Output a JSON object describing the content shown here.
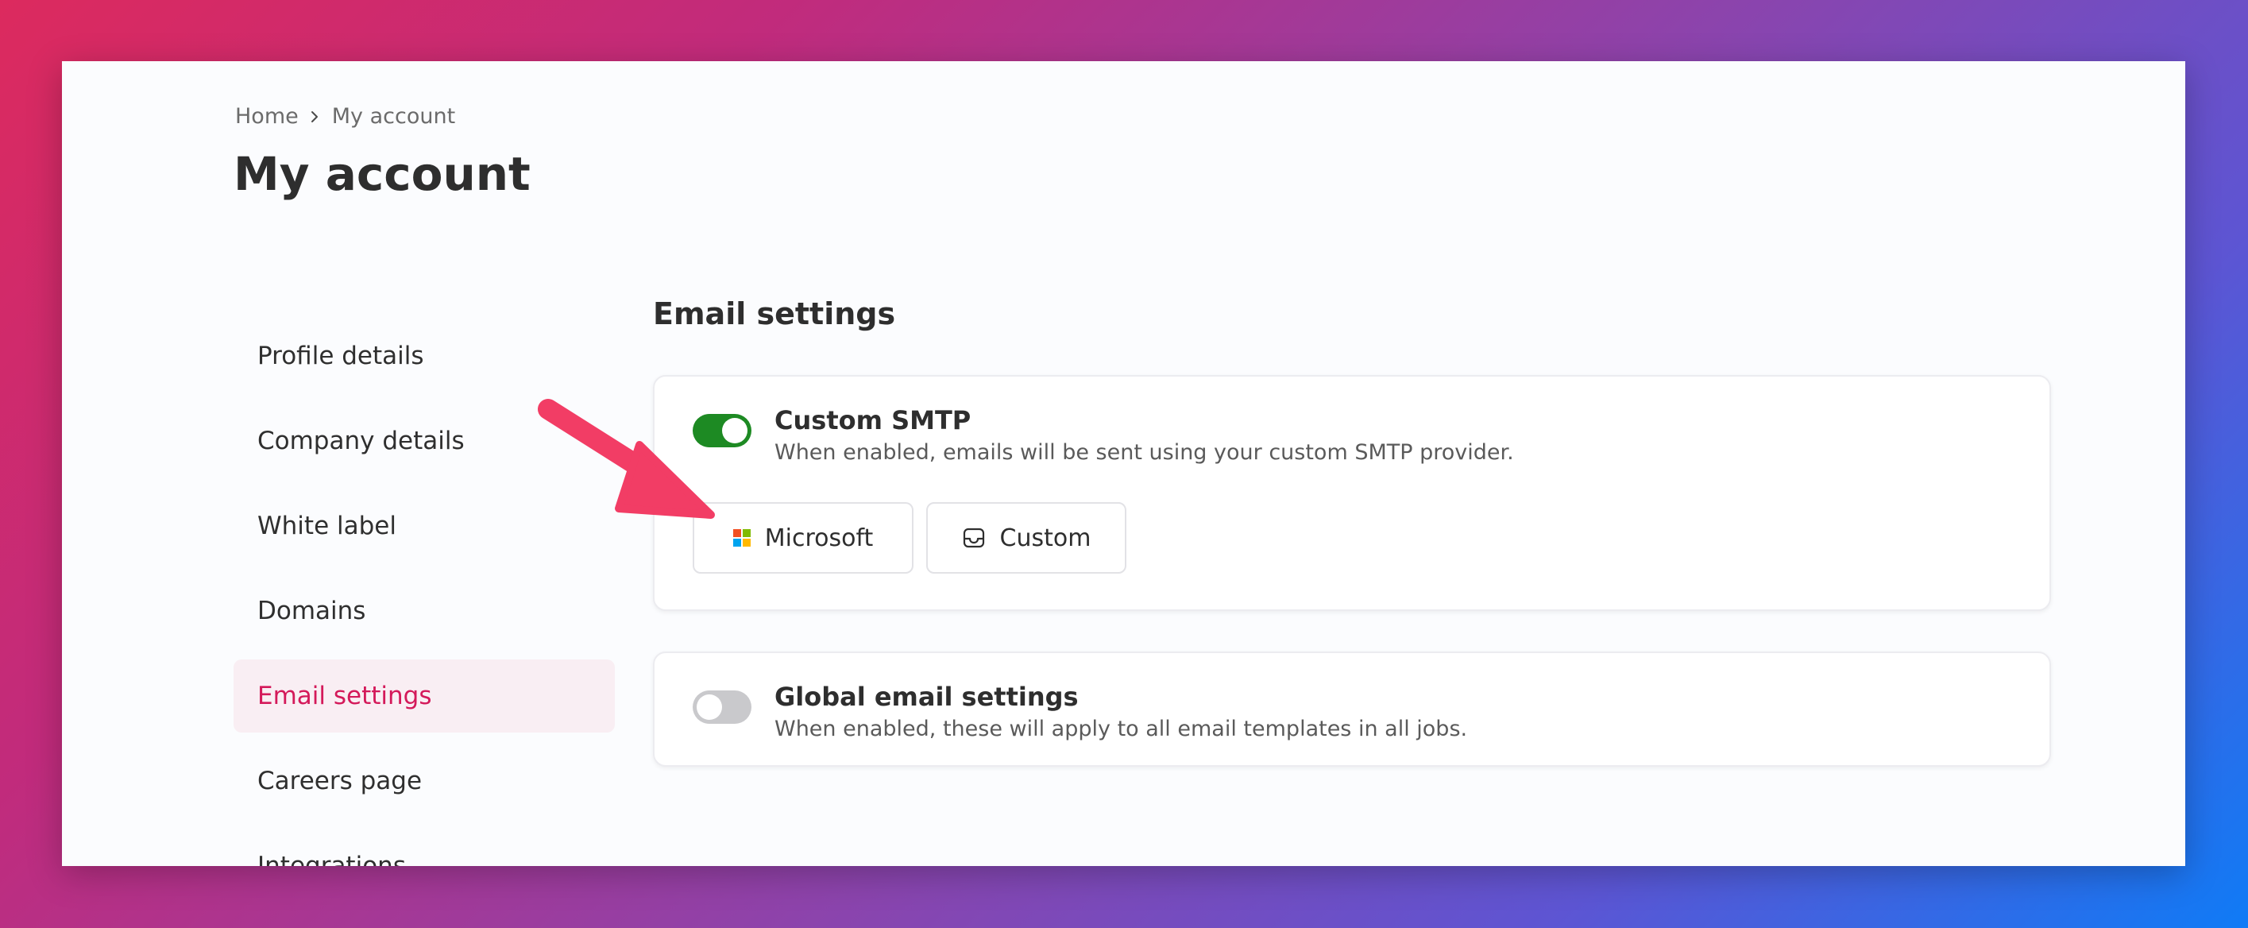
{
  "breadcrumb": {
    "home": "Home",
    "current": "My account"
  },
  "page": {
    "title": "My account"
  },
  "sidebar": {
    "items": [
      {
        "label": "Profile details",
        "active": false
      },
      {
        "label": "Company details",
        "active": false
      },
      {
        "label": "White label",
        "active": false
      },
      {
        "label": "Domains",
        "active": false
      },
      {
        "label": "Email settings",
        "active": true
      },
      {
        "label": "Careers page",
        "active": false
      },
      {
        "label": "Integrations",
        "active": false
      }
    ]
  },
  "main": {
    "section_title": "Email settings",
    "smtp_card": {
      "toggle_on": true,
      "title": "Custom SMTP",
      "description": "When enabled, emails will be sent using your custom SMTP provider.",
      "providers": [
        {
          "label": "Microsoft",
          "icon": "microsoft-logo-icon"
        },
        {
          "label": "Custom",
          "icon": "inbox-icon"
        }
      ]
    },
    "global_card": {
      "toggle_on": false,
      "title": "Global email settings",
      "description": "When enabled, these will apply to all email templates in all jobs."
    }
  },
  "colors": {
    "accent": "#d4195a",
    "active_bg": "#f9eef3",
    "toggle_on": "#1d8a23",
    "toggle_off": "#c9c9cc",
    "annotation_arrow": "#f23d65"
  }
}
